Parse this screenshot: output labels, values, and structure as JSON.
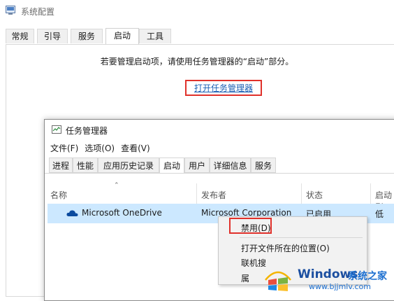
{
  "sysconfig": {
    "title": "系统配置",
    "tabs": [
      {
        "label": "常规",
        "active": false
      },
      {
        "label": "引导",
        "active": false
      },
      {
        "label": "服务",
        "active": false
      },
      {
        "label": "启动",
        "active": true
      },
      {
        "label": "工具",
        "active": false
      }
    ],
    "message": "若要管理启动项，请使用任务管理器的“启动”部分。",
    "link": "打开任务管理器"
  },
  "taskmgr": {
    "title": "任务管理器",
    "menu": [
      "文件(F)",
      "选项(O)",
      "查看(V)"
    ],
    "tabs": [
      {
        "label": "进程",
        "active": false
      },
      {
        "label": "性能",
        "active": false
      },
      {
        "label": "应用历史记录",
        "active": false
      },
      {
        "label": "启动",
        "active": true
      },
      {
        "label": "用户",
        "active": false
      },
      {
        "label": "详细信息",
        "active": false
      },
      {
        "label": "服务",
        "active": false
      }
    ],
    "columns": {
      "name": "名称",
      "publisher": "发布者",
      "status": "状态",
      "impact": "启动影"
    },
    "row": {
      "icon": "onedrive-cloud-icon",
      "name": "Microsoft OneDrive",
      "publisher": "Microsoft Corporation",
      "status": "已启用",
      "impact": "低"
    }
  },
  "context_menu": {
    "items": [
      "禁用(D)",
      "打开文件所在的位置(O)",
      "联机搜",
      "属"
    ]
  },
  "watermark": {
    "brand": "Windows",
    "brand_cn": "系统之家",
    "url": "www.bjjmlv.com"
  },
  "colors": {
    "highlight_box": "#e0312b",
    "link": "#1a5fb4",
    "selected_row": "#cce8ff"
  }
}
